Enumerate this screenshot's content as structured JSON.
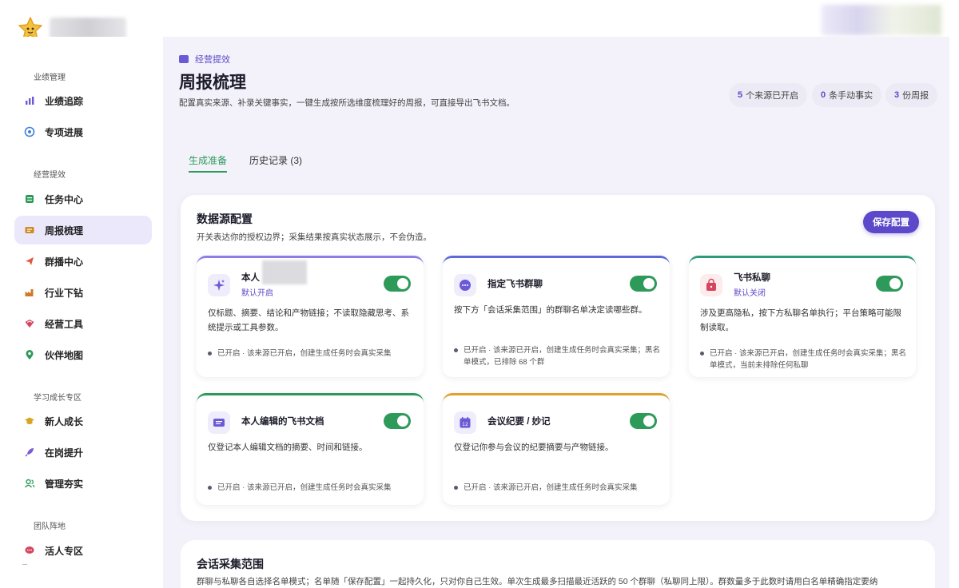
{
  "sidebar": {
    "sections": [
      "业绩管理",
      "经营提效",
      "学习成长专区",
      "团队阵地"
    ],
    "items": [
      {
        "label": "业绩追踪",
        "icon": "bar-chart-icon",
        "color": "#6a5ad6"
      },
      {
        "label": "专项进展",
        "icon": "target-icon",
        "color": "#3f7fd6"
      },
      {
        "label": "任务中心",
        "icon": "task-list-icon",
        "color": "#2e9a5a"
      },
      {
        "label": "周报梳理",
        "icon": "report-icon",
        "color": "#d08a22"
      },
      {
        "label": "群播中心",
        "icon": "send-icon",
        "color": "#e0573b"
      },
      {
        "label": "行业下钻",
        "icon": "factory-icon",
        "color": "#d0782c"
      },
      {
        "label": "经营工具",
        "icon": "toolbox-icon",
        "color": "#d6455d"
      },
      {
        "label": "伙伴地图",
        "icon": "map-pin-icon",
        "color": "#2e9a5a"
      },
      {
        "label": "新人成长",
        "icon": "graduation-cap-icon",
        "color": "#d9a520"
      },
      {
        "label": "在岗提升",
        "icon": "rocket-icon",
        "color": "#7a5ad6"
      },
      {
        "label": "管理夯实",
        "icon": "users-icon",
        "color": "#2e9a5a"
      },
      {
        "label": "活人专区",
        "icon": "chat-bubble-icon",
        "color": "#d6455d"
      }
    ]
  },
  "header": {
    "breadcrumb": "经营提效",
    "title": "周报梳理",
    "description": "配置真实来源、补录关键事实，一键生成按所选维度梳理好的周报，可直接导出飞书文档。",
    "stats": [
      {
        "value": "5",
        "label": "个来源已开启"
      },
      {
        "value": "0",
        "label": "条手动事实"
      },
      {
        "value": "3",
        "label": "份周报"
      }
    ]
  },
  "tabs": [
    {
      "label": "生成准备"
    },
    {
      "label": "历史记录 (3)"
    }
  ],
  "panel": {
    "title": "数据源配置",
    "description": "开关表达你的授权边界；采集结果按真实状态展示，不会伪造。",
    "save_label": "保存配置",
    "cards": [
      {
        "title": "本人",
        "subtitle": "默认开启",
        "desc": "仅标题、摘要、结论和产物链接；不读取隐藏思考、系统提示或工具参数。",
        "status": "已开启 · 该来源已开启，创建生成任务时会真实采集",
        "icon": "sparkle-icon",
        "accent": "#8c7ee6",
        "enabled": true
      },
      {
        "title": "指定飞书群聊",
        "desc": "按下方「会话采集范围」的群聊名单决定读哪些群。",
        "status": "已开启 · 该来源已开启，创建生成任务时会真实采集；黑名单模式，已排除 68 个群",
        "icon": "chat-group-icon",
        "accent": "#5b6ad6",
        "enabled": true
      },
      {
        "title": "飞书私聊",
        "subtitle": "默认关闭",
        "desc": "涉及更高隐私，按下方私聊名单执行；平台策略可能限制读取。",
        "status": "已开启 · 该来源已开启，创建生成任务时会真实采集；黑名单模式，当前未排除任何私聊",
        "icon": "lock-bag-icon",
        "accent": "#2e9a7a",
        "enabled": true
      },
      {
        "title": "本人编辑的飞书文档",
        "desc": "仅登记本人编辑文档的摘要、时间和链接。",
        "status": "已开启 · 该来源已开启，创建生成任务时会真实采集",
        "icon": "document-icon",
        "accent": "#2e9a5a",
        "enabled": true
      },
      {
        "title": "会议纪要 / 妙记",
        "desc": "仅登记你参与会议的纪要摘要与产物链接。",
        "status": "已开启 · 该来源已开启，创建生成任务时会真实采集",
        "icon": "calendar-icon",
        "accent": "#e0a030",
        "enabled": true
      }
    ]
  },
  "panel2": {
    "title": "会话采集范围",
    "description": "群聊与私聊各自选择名单模式；名单随「保存配置」一起持久化，只对你自己生效。单次生成最多扫描最近活跃的 50 个群聊（私聊同上限）。群数量多于此数时请用白名单精确指定要纳"
  },
  "colors": {
    "accent": "#5b49c9",
    "toggle_on": "#2e9a5a",
    "background": "#f3f2fa"
  }
}
